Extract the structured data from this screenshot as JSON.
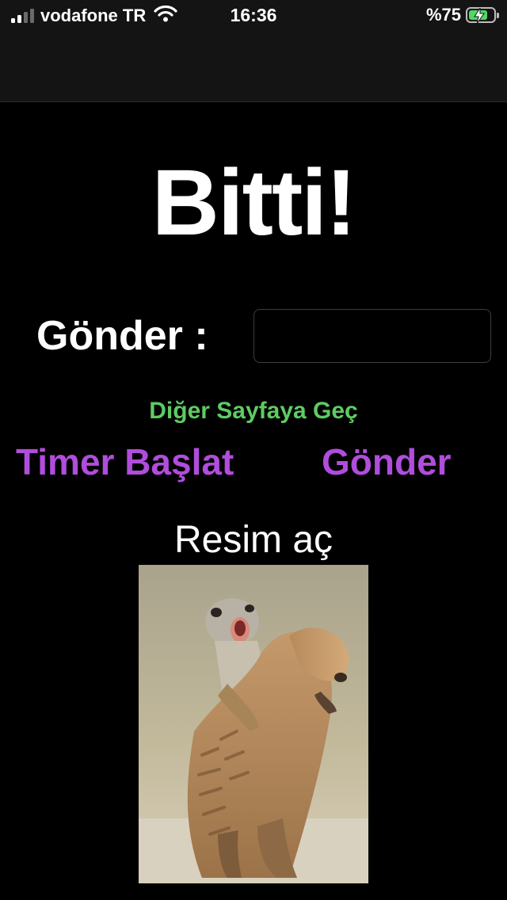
{
  "status_bar": {
    "carrier": "vodafone TR",
    "time": "16:36",
    "battery_percent": "%75",
    "battery_level": 0.75,
    "charging": true
  },
  "main": {
    "title": "Bitti!",
    "send_label": "Gönder :",
    "send_input": {
      "value": "",
      "placeholder": ""
    },
    "next_page_link": "Diğer Sayfaya Geç",
    "timer_button": "Timer Başlat",
    "send_button": "Gönder",
    "open_image_button": "Resim aç"
  },
  "colors": {
    "background": "#000000",
    "status_bar_bg": "#141414",
    "link_green": "#5ecb63",
    "button_purple": "#b04ddc",
    "battery_green": "#4cd964"
  },
  "icons": [
    "signal-icon",
    "wifi-icon",
    "battery-icon",
    "charging-bolt-icon"
  ]
}
